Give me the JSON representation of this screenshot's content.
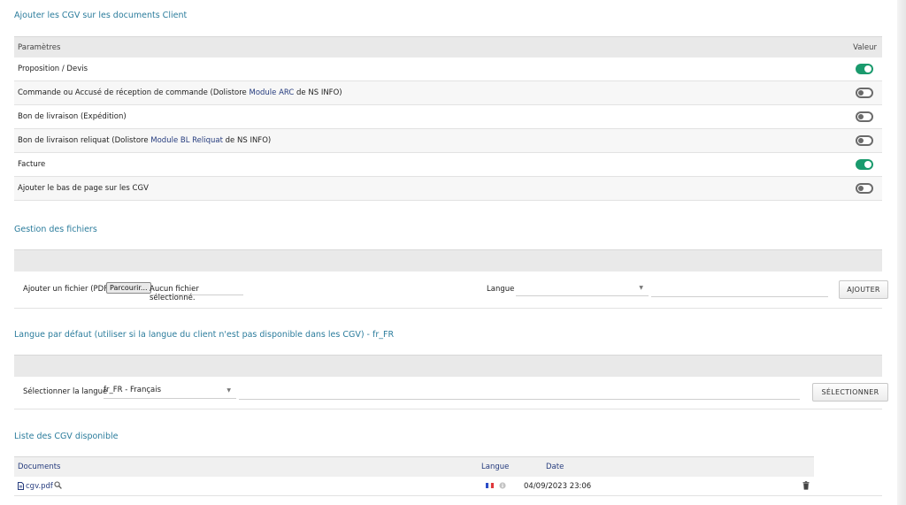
{
  "sections": {
    "cgv_title": "Ajouter les CGV sur les documents Client",
    "files_title": "Gestion des fichiers",
    "default_lang_title": "Langue par défaut (utiliser si la langue du client n'est pas disponible dans les CGV) - fr_FR",
    "list_title": "Liste des CGV disponible"
  },
  "settings": {
    "header_param": "Paramètres",
    "header_value": "Valeur",
    "rows": [
      {
        "pre": "Proposition / Devis",
        "link": "",
        "post": "",
        "on": true
      },
      {
        "pre": "Commande ou Accusé de réception de commande (Dolistore ",
        "link": "Module ARC",
        "post": " de NS INFO)",
        "on": false
      },
      {
        "pre": "Bon de livraison (Expédition)",
        "link": "",
        "post": "",
        "on": false
      },
      {
        "pre": "Bon de livraison reliquat (Dolistore ",
        "link": "Module BL Reliquat",
        "post": " de NS INFO)",
        "on": false
      },
      {
        "pre": "Facture",
        "link": "",
        "post": "",
        "on": true
      },
      {
        "pre": "Ajouter le bas de page sur les CGV",
        "link": "",
        "post": "",
        "on": false
      }
    ]
  },
  "upload": {
    "label": "Ajouter un fichier (PDF)",
    "browse": "Parcourir...",
    "no_file": "Aucun fichier sélectionné.",
    "lang_label": "Langue",
    "lang_value": "",
    "add_button": "AJOUTER"
  },
  "default_lang": {
    "label": "Sélectionner la langue",
    "value": "fr_FR - Français",
    "button": "SÉLECTIONNER"
  },
  "list": {
    "headers": {
      "documents": "Documents",
      "langue": "Langue",
      "date": "Date"
    },
    "rows": [
      {
        "file": "cgv.pdf",
        "date": "04/09/2023 23:06"
      }
    ]
  },
  "colors": {
    "accent": "#2b7c9c",
    "toggle_on": "#1a9a6d",
    "link": "#263c7e"
  }
}
